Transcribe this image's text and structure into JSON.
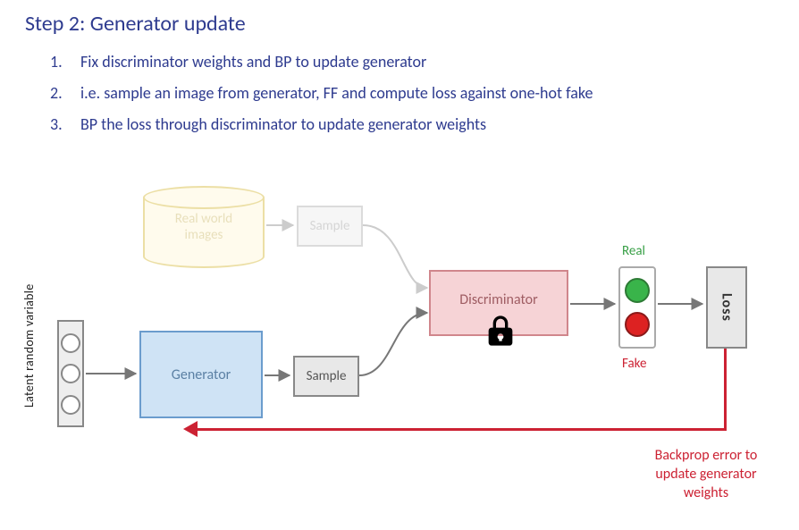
{
  "title": "Step 2: Generator update",
  "steps": [
    "Fix discriminator weights and BP to update generator",
    "i.e. sample an image from generator, FF and compute loss against one-hot fake",
    "BP the loss through discriminator to update generator weights"
  ],
  "diagram": {
    "latent_label": "Latent random variable",
    "real_world": "Real world\nimages",
    "sample": "Sample",
    "generator": "Generator",
    "discriminator": "Discriminator",
    "loss": "Loss",
    "real": "Real",
    "fake": "Fake",
    "backprop": "Backprop error to\nupdate generator\nweights"
  },
  "chart_data": {
    "type": "diagram",
    "title": "GAN training — Step 2: Generator update",
    "nodes": [
      {
        "id": "latent",
        "label": "Latent random variable",
        "kind": "input-vector"
      },
      {
        "id": "real_images",
        "label": "Real world images",
        "kind": "dataset",
        "state": "ghosted"
      },
      {
        "id": "sample_real",
        "label": "Sample",
        "kind": "op",
        "state": "ghosted"
      },
      {
        "id": "generator",
        "label": "Generator",
        "kind": "network",
        "trainable": true
      },
      {
        "id": "sample_fake",
        "label": "Sample",
        "kind": "op"
      },
      {
        "id": "discriminator",
        "label": "Discriminator",
        "kind": "network",
        "trainable": false,
        "locked": true
      },
      {
        "id": "decision",
        "label": "Real / Fake",
        "kind": "output",
        "options": [
          "Real",
          "Fake"
        ]
      },
      {
        "id": "loss",
        "label": "Loss",
        "kind": "loss"
      }
    ],
    "edges_forward": [
      {
        "from": "latent",
        "to": "generator"
      },
      {
        "from": "generator",
        "to": "sample_fake"
      },
      {
        "from": "sample_fake",
        "to": "discriminator"
      },
      {
        "from": "real_images",
        "to": "sample_real",
        "state": "ghosted"
      },
      {
        "from": "sample_real",
        "to": "discriminator",
        "state": "ghosted"
      },
      {
        "from": "discriminator",
        "to": "decision"
      },
      {
        "from": "decision",
        "to": "loss"
      }
    ],
    "edges_backward": [
      {
        "from": "loss",
        "to": "generator",
        "label": "Backprop error to update generator weights",
        "through": [
          "discriminator"
        ]
      }
    ]
  }
}
